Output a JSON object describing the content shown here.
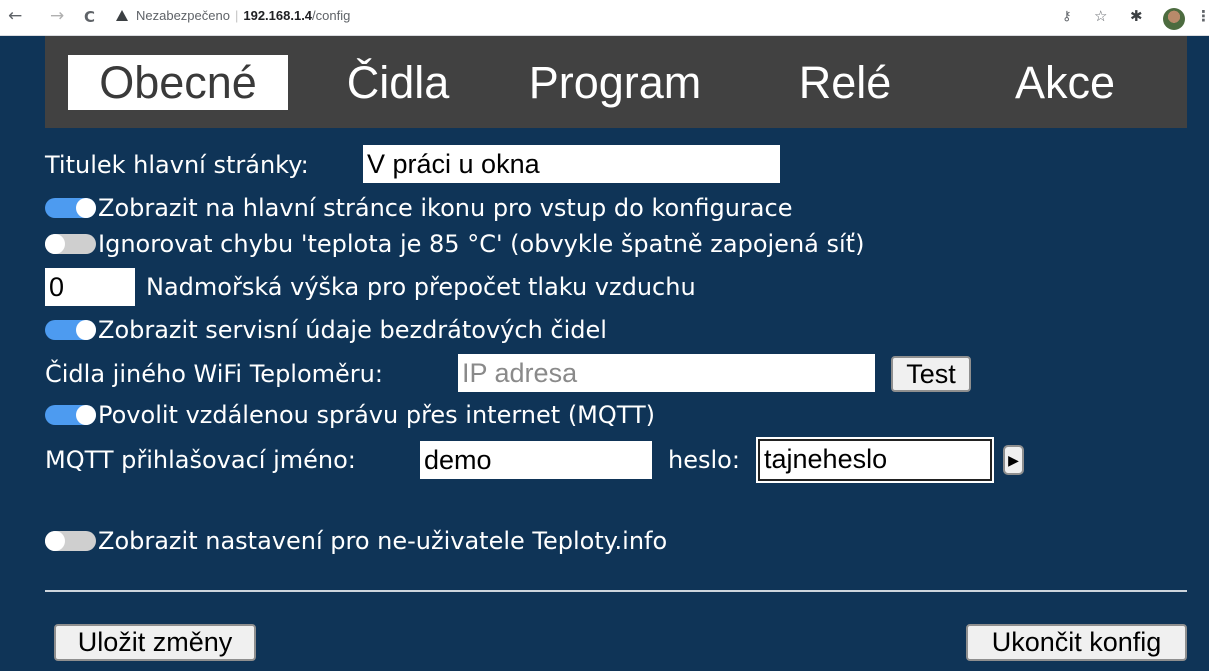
{
  "browser": {
    "back": "←",
    "forward": "→",
    "reload": "C",
    "security_label": "Nezabezpečeno",
    "host": "192.168.1.4",
    "path": "/config",
    "key_icon": "key-icon",
    "star_icon": "star-icon",
    "extensions_icon": "puzzle-icon",
    "menu": "⋮"
  },
  "tabs": [
    {
      "label": "Obecné",
      "active": true
    },
    {
      "label": "Čidla",
      "active": false
    },
    {
      "label": "Program",
      "active": false
    },
    {
      "label": "Relé",
      "active": false
    },
    {
      "label": "Akce",
      "active": false
    }
  ],
  "form": {
    "title_label": "Titulek hlavní stránky:",
    "title_value": "V práci u okna",
    "show_config_icon": {
      "label": "Zobrazit na hlavní stránce ikonu pro vstup do konfigurace",
      "on": true
    },
    "ignore_85": {
      "label": "Ignorovat chybu 'teplota je 85 °C' (obvykle špatně zapojená síť)",
      "on": false
    },
    "altitude_value": "0",
    "altitude_label": "Nadmořská výška pro přepočet tlaku vzduchu",
    "show_service": {
      "label": "Zobrazit servisní údaje bezdrátových čidel",
      "on": true
    },
    "other_wifi_label": "Čidla jiného WiFi Teploměru:",
    "other_wifi_placeholder": "IP adresa",
    "test_button": "Test",
    "allow_mqtt": {
      "label": "Povolit vzdálenou správu přes internet (MQTT)",
      "on": true
    },
    "mqtt_user_label": "MQTT přihlašovací jméno:",
    "mqtt_user_value": "demo",
    "mqtt_pass_label": "heslo:",
    "mqtt_pass_value": "tajneheslo",
    "show_non_user": {
      "label": "Zobrazit nastavení pro ne-uživatele Teploty.info",
      "on": false
    }
  },
  "footer": {
    "save_button": "Uložit změny",
    "exit_button": "Ukončit konfig"
  },
  "colors": {
    "background": "#0f3457",
    "tabbar": "#414141",
    "toggle_on": "#4d9bf0",
    "toggle_off": "#cfcfcf"
  }
}
